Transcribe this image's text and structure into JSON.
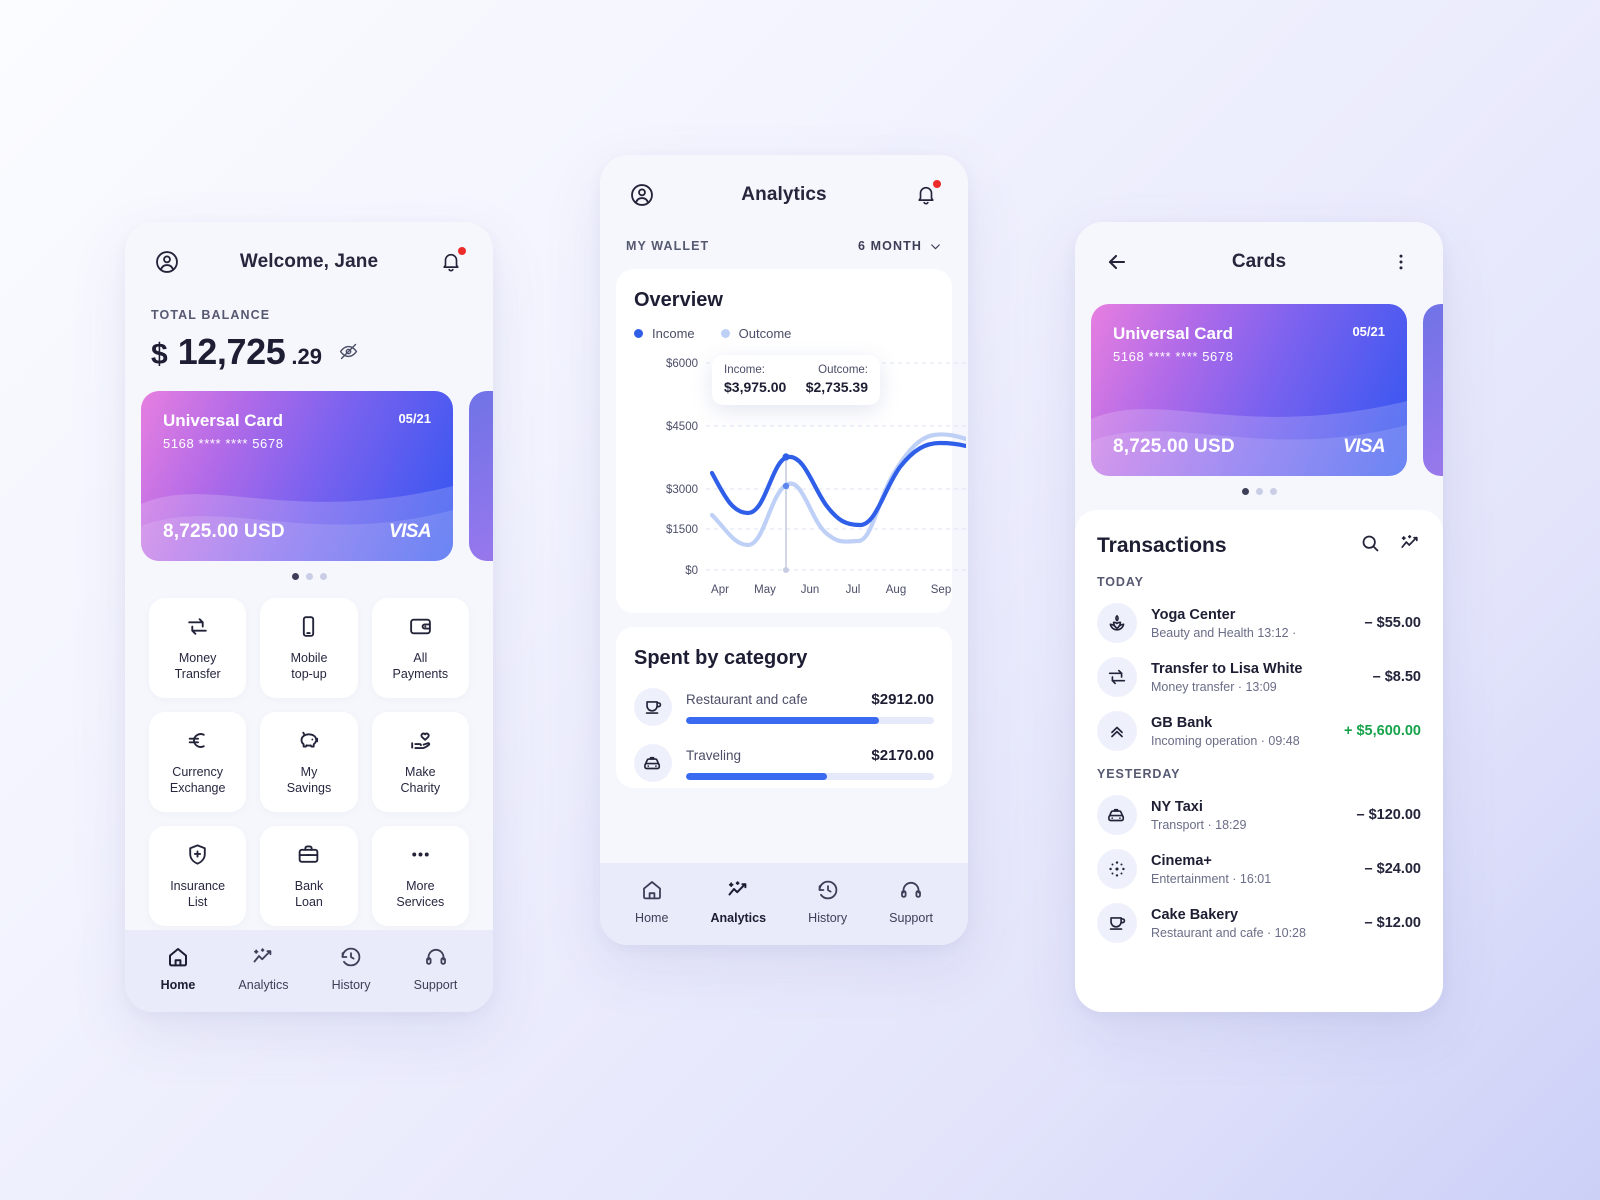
{
  "screen_home": {
    "header": {
      "title": "Welcome, Jane",
      "profile_icon": "user-circle-icon",
      "bell_icon": "bell-icon"
    },
    "balance": {
      "label": "TOTAL BALANCE",
      "currency": "$",
      "integer": "12,725",
      "decimal": ".29",
      "eye_icon": "eye-off-icon"
    },
    "card": {
      "name": "Universal Card",
      "expiry": "05/21",
      "number": "5168 **** **** 5678",
      "amount": "8,725.00 USD",
      "brand": "VISA"
    },
    "carousel_dots": 3,
    "carousel_active": 0,
    "tiles": [
      {
        "label": "Money\nTransfer",
        "icon": "transfer-arrows-icon"
      },
      {
        "label": "Mobile\ntop-up",
        "icon": "smartphone-icon"
      },
      {
        "label": "All\nPayments",
        "icon": "wallet-icon"
      },
      {
        "label": "Currency\nExchange",
        "icon": "euro-icon"
      },
      {
        "label": "My\nSavings",
        "icon": "piggy-bank-icon"
      },
      {
        "label": "Make\nCharity",
        "icon": "hand-heart-icon"
      },
      {
        "label": "Insurance\nList",
        "icon": "shield-plus-icon"
      },
      {
        "label": "Bank\nLoan",
        "icon": "briefcase-icon"
      },
      {
        "label": "More\nServices",
        "icon": "ellipsis-icon"
      }
    ],
    "tabs": [
      {
        "label": "Home",
        "icon": "home-icon",
        "active": true
      },
      {
        "label": "Analytics",
        "icon": "analytics-icon",
        "active": false
      },
      {
        "label": "History",
        "icon": "history-icon",
        "active": false
      },
      {
        "label": "Support",
        "icon": "headset-icon",
        "active": false
      }
    ]
  },
  "screen_analytics": {
    "header": {
      "title": "Analytics",
      "profile_icon": "user-circle-icon",
      "bell_icon": "bell-icon"
    },
    "wallet_label": "MY WALLET",
    "period": "6 MONTH",
    "overview": {
      "title": "Overview",
      "legend": [
        {
          "label": "Income",
          "color": "#2f5fe8"
        },
        {
          "label": "Outcome",
          "color": "#bfd0f7"
        }
      ],
      "tooltip": {
        "income_label": "Income:",
        "income_value": "$3,975.00",
        "outcome_label": "Outcome:",
        "outcome_value": "$2,735.39"
      }
    },
    "spent": {
      "title": "Spent by category",
      "items": [
        {
          "name": "Restaurant and cafe",
          "amount": "$2912.00",
          "pct": 78,
          "icon": "coffee-cup-icon"
        },
        {
          "name": "Traveling",
          "amount": "$2170.00",
          "pct": 57,
          "icon": "taxi-icon"
        }
      ]
    },
    "tabs": [
      {
        "label": "Home",
        "icon": "home-icon",
        "active": false
      },
      {
        "label": "Analytics",
        "icon": "analytics-icon",
        "active": true
      },
      {
        "label": "History",
        "icon": "history-icon",
        "active": false
      },
      {
        "label": "Support",
        "icon": "headset-icon",
        "active": false
      }
    ]
  },
  "screen_cards": {
    "header": {
      "title": "Cards",
      "back_icon": "arrow-left-icon",
      "menu_icon": "more-vertical-icon"
    },
    "card": {
      "name": "Universal Card",
      "expiry": "05/21",
      "number": "5168 **** **** 5678",
      "amount": "8,725.00 USD",
      "brand": "VISA"
    },
    "carousel_dots": 3,
    "carousel_active": 0,
    "transactions": {
      "title": "Transactions",
      "search_icon": "search-icon",
      "stats_icon": "analytics-icon",
      "groups": [
        {
          "day": "TODAY",
          "items": [
            {
              "name": "Yoga Center",
              "sub": "Beauty and Health  13:12  ·",
              "amount": "– $55.00",
              "positive": false,
              "icon": "lotus-icon"
            },
            {
              "name": "Transfer to Lisa White",
              "sub": "Money transfer  ·  13:09",
              "amount": "– $8.50",
              "positive": false,
              "icon": "transfer-arrows-icon"
            },
            {
              "name": "GB Bank",
              "sub": "Incoming operation  ·  09:48",
              "amount": "+ $5,600.00",
              "positive": true,
              "icon": "chevrons-up-icon"
            }
          ]
        },
        {
          "day": "YESTERDAY",
          "items": [
            {
              "name": "NY Taxi",
              "sub": "Transport  ·  18:29",
              "amount": "– $120.00",
              "positive": false,
              "icon": "taxi-icon"
            },
            {
              "name": "Cinema+",
              "sub": "Entertainment  ·  16:01",
              "amount": "– $24.00",
              "positive": false,
              "icon": "sparkle-burst-icon"
            },
            {
              "name": "Cake Bakery",
              "sub": "Restaurant and cafe  ·  10:28",
              "amount": "– $12.00",
              "positive": false,
              "icon": "coffee-cup-icon"
            }
          ]
        }
      ]
    }
  },
  "chart_data": {
    "type": "line",
    "title": "Overview",
    "xlabel": "",
    "ylabel": "",
    "x": [
      "Apr",
      "May",
      "Jun",
      "Jul",
      "Aug",
      "Sep"
    ],
    "ytick_labels": [
      "$0",
      "$1500",
      "$3000",
      "$4500",
      "$6000"
    ],
    "ylim": [
      0,
      6000
    ],
    "grid": true,
    "legend_position": "top-left",
    "series": [
      {
        "name": "Income",
        "color": "#2f5fe8",
        "values": [
          3450,
          2150,
          3750,
          2900,
          2000,
          3800
        ]
      },
      {
        "name": "Outcome",
        "color": "#bfd0f7",
        "values": [
          2000,
          1150,
          2820,
          1650,
          1850,
          4200
        ]
      }
    ],
    "annotation": {
      "x": "May/Jun midpoint",
      "income_value": 3975,
      "outcome_value": 2735.39,
      "income_label": "Income:",
      "outcome_label": "Outcome:",
      "income_text": "$3,975.00",
      "outcome_text": "$2,735.39"
    }
  },
  "colors": {
    "accent": "#3a6af0",
    "income": "#2f5fe8",
    "outcome": "#bfd0f7",
    "positive": "#16a34a",
    "badge": "#ec2b2b",
    "card_gradient_from": "#e77fe0",
    "card_gradient_to": "#2f55f0"
  }
}
